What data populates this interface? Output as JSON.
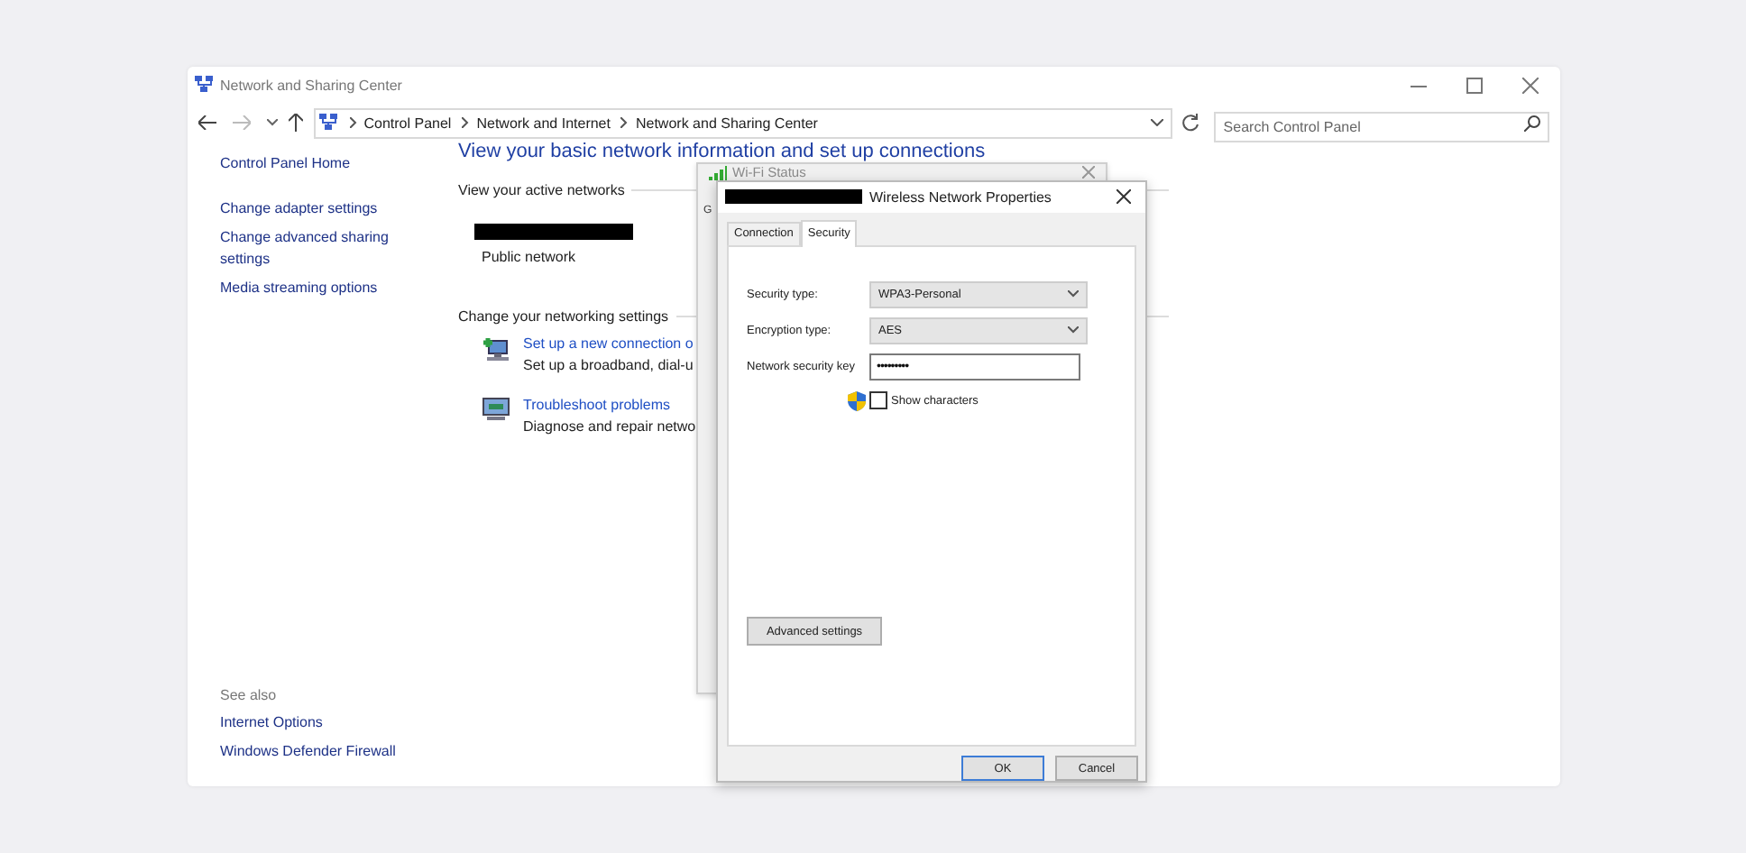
{
  "window": {
    "title": "Network and Sharing Center"
  },
  "address_bar": {
    "breadcrumbs": [
      "Control Panel",
      "Network and Internet",
      "Network and Sharing Center"
    ]
  },
  "search": {
    "placeholder": "Search Control Panel"
  },
  "sidebar": {
    "items": [
      "Control Panel Home",
      "Change adapter settings",
      "Change advanced sharing settings",
      "Media streaming options"
    ],
    "see_also_label": "See also",
    "see_also": [
      "Internet Options",
      "Windows Defender Firewall"
    ]
  },
  "main": {
    "heading": "View your basic network information and set up connections",
    "active_networks_label": "View your active networks",
    "network_type": "Public network",
    "settings_label": "Change your networking settings",
    "tasks": [
      {
        "kind": "connection",
        "link": "Set up a new connection o",
        "description": "Set up a broadband, dial-u"
      },
      {
        "kind": "troubleshoot",
        "link": "Troubleshoot problems",
        "description": "Diagnose and repair netwo"
      }
    ]
  },
  "status_window": {
    "title": "Wi-Fi Status",
    "tab_fragment": "G"
  },
  "dialog": {
    "title": "Wireless Network Properties",
    "tabs": [
      {
        "label": "Connection",
        "selected": false
      },
      {
        "label": "Security",
        "selected": true
      }
    ],
    "fields": [
      {
        "kind": "select",
        "label": "Security type:",
        "value": "WPA3-Personal"
      },
      {
        "kind": "select",
        "label": "Encryption type:",
        "value": "AES"
      },
      {
        "kind": "password",
        "label": "Network security key",
        "value": "•••••••••"
      }
    ],
    "show_characters": {
      "label": "Show characters",
      "checked": false
    },
    "advanced_button": "Advanced settings",
    "buttons": [
      {
        "label": "OK",
        "default": true
      },
      {
        "label": "Cancel",
        "default": false
      }
    ]
  }
}
